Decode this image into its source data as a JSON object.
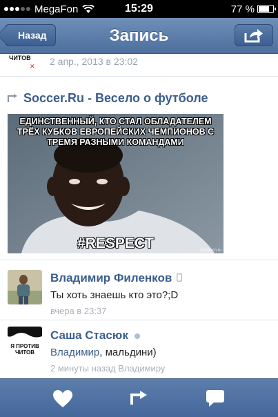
{
  "status_bar": {
    "carrier": "MegaFon",
    "time": "15:29",
    "battery_percent": "77 %",
    "battery_level": 0.77
  },
  "nav": {
    "back_label": "Назад",
    "title": "Запись",
    "share_icon": "share-icon"
  },
  "top_item": {
    "logo_text": "ЧИТОВ",
    "date": "2 апр., 2013 в 23:02"
  },
  "post": {
    "repost_icon": "repost-icon",
    "source": "Soccer.Ru - Весело о футболе",
    "image": {
      "caption_lines": [
        "ЕДИНСТВЕННЫЙ, КТО СТАЛ ОБЛАДАТЕЛЕМ",
        "ТРЁХ КУБКОВ ЕВРОПЕЙСКИХ ЧЕМПИОНОВ С",
        "ТРЕМЯ РАЗНЫМИ КОМАНДАМИ"
      ],
      "tag": "#RESPECT",
      "site": "mapyach.ru"
    }
  },
  "comments": [
    {
      "name": "Владимир Филенков",
      "text": "Ты хоть знаешь кто это?;D",
      "time": "вчера в 23:37",
      "device_icon": "mobile-icon"
    },
    {
      "name": "Саша Стасюк",
      "text_link": "Владимир",
      "text_rest": ", мальдини)",
      "time": "2 минуты назад Владимиру",
      "avatar_text": "Я ПРОТИВ ЧИТОВ",
      "online_icon": "online-dot-icon"
    }
  ],
  "tab_bar": {
    "items": [
      "like-icon",
      "repost-icon",
      "comment-icon"
    ]
  },
  "colors": {
    "nav_blue": "#4c6f9d",
    "link_blue": "#3b5d8c",
    "meta_gray": "#98a2ad"
  }
}
